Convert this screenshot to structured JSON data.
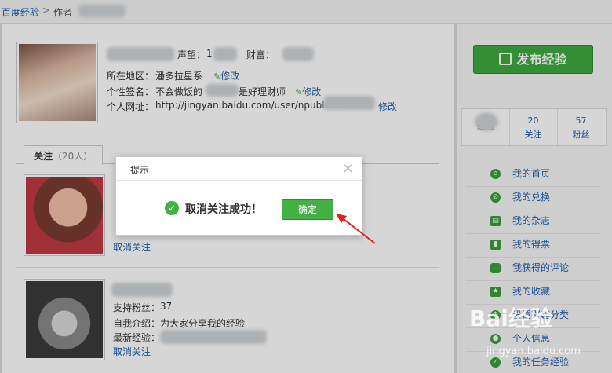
{
  "breadcrumb": {
    "home": "百度经验",
    "separator": ">",
    "current": "作者"
  },
  "profile": {
    "reputation_label": "声望：",
    "reputation_value": "1",
    "wealth_label": "财富：",
    "location_label": "所在地区：",
    "location_value": "潘多拉星系",
    "signature_label": "个性签名：",
    "signature_value_a": "不会做饭的",
    "signature_value_b": "是好理财师",
    "url_label": "个人网址：",
    "url_value": "http://jingyan.baidu.com/user/npublic?un",
    "edit_label": "修改"
  },
  "tab": {
    "label": "关注",
    "count": "（20人）"
  },
  "follows": [
    {
      "unfollow": "取消关注"
    },
    {
      "fans_label": "支持粉丝：",
      "fans_value": "37",
      "intro_label": "自我介绍：",
      "intro_value": "为大家分享我的经验",
      "latest_label": "最新经验：",
      "unfollow": "取消关注"
    }
  ],
  "sidebar": {
    "publish": "发布经验",
    "stats": [
      {
        "num": "",
        "label": "经验"
      },
      {
        "num": "20",
        "label": "关注"
      },
      {
        "num": "57",
        "label": "粉丝"
      }
    ],
    "menu": [
      {
        "label": "我的首页",
        "icon": "home-icon"
      },
      {
        "label": "我的兑换",
        "icon": "exchange-icon"
      },
      {
        "label": "我的杂志",
        "icon": "magazine-icon"
      },
      {
        "label": "我的得票",
        "icon": "vote-chart-icon"
      },
      {
        "label": "我获得的评论",
        "icon": "comment-icon"
      },
      {
        "label": "我的收藏",
        "icon": "favorite-icon"
      },
      {
        "label": "设置兴趣分类",
        "icon": "settings-icon"
      },
      {
        "label": "个人信息",
        "icon": "profile-icon"
      },
      {
        "label": "我的任务经验",
        "icon": "task-icon"
      }
    ]
  },
  "dialog": {
    "title": "提示",
    "message": "取消关注成功！",
    "ok": "确定"
  },
  "watermark": {
    "logo": "Bai经验",
    "url": "jingyan.baidu.com"
  },
  "colors": {
    "accent_green": "#3fab3f",
    "link_blue": "#1f5fb0",
    "arrow_red": "#e02020"
  }
}
